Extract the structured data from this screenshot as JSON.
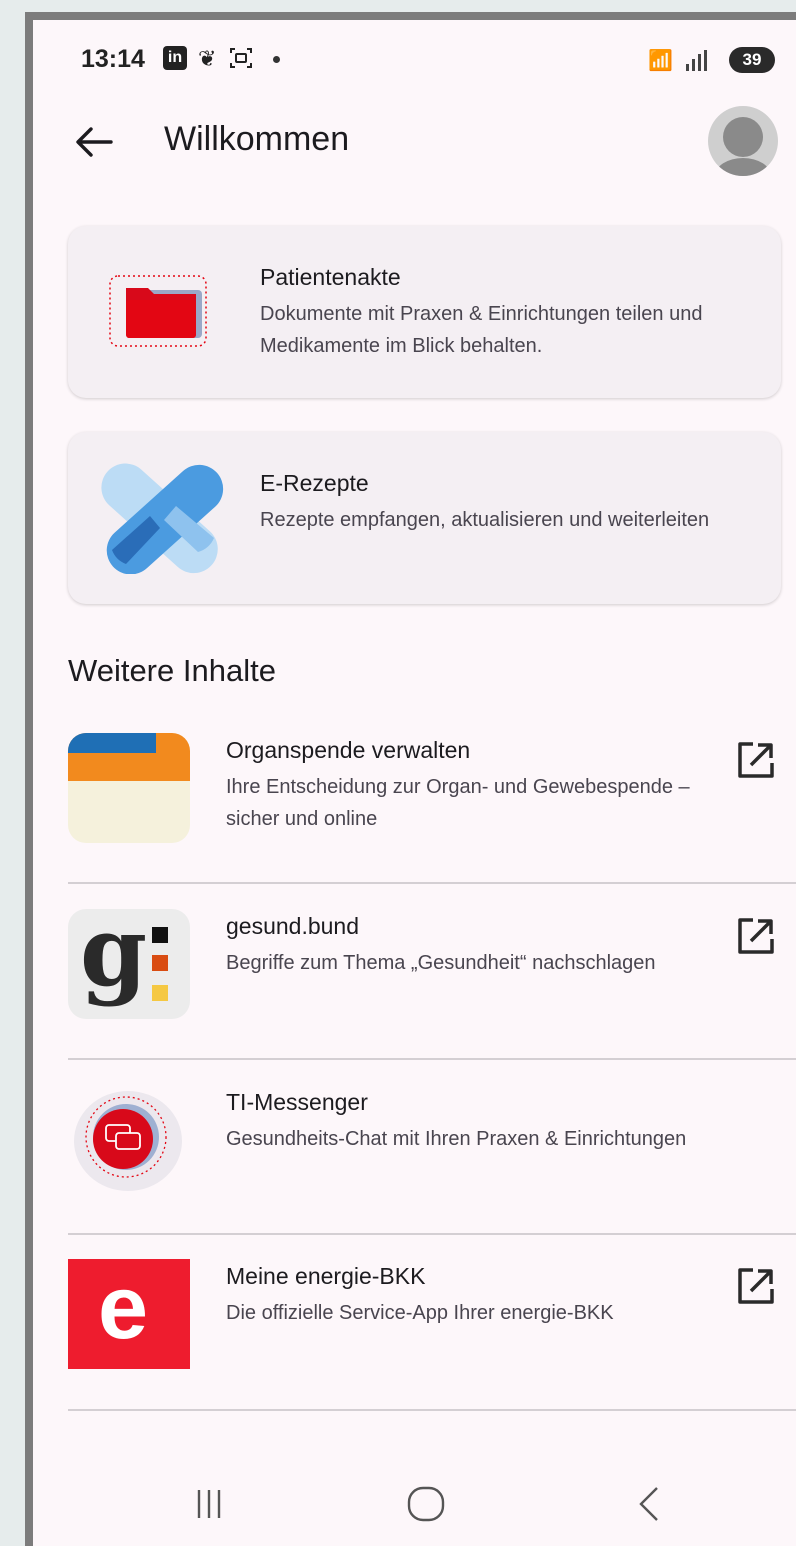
{
  "status_bar": {
    "time": "13:14",
    "linkedin_icon": "in",
    "battery": "39",
    "icons": [
      "linkedin-icon",
      "leaf-icon",
      "screenshot-icon",
      "notification-dot",
      "wifi-icon",
      "signal-icon",
      "battery-icon"
    ]
  },
  "app_bar": {
    "title": "Willkommen",
    "back_icon": "arrow-left-icon",
    "avatar_icon": "profile-avatar"
  },
  "cards": [
    {
      "title": "Patientenakte",
      "subtitle": "Dokumente mit Praxen & Einrichtungen teilen und Medikamente im Blick behalten.",
      "icon": "folder-icon"
    },
    {
      "title": "E-Rezepte",
      "subtitle": "Rezepte empfangen, aktualisieren und weiterleiten",
      "icon": "prescription-icon"
    }
  ],
  "section_title": "Weitere Inhalte",
  "more": [
    {
      "title": "Organspende verwalten",
      "subtitle": "Ihre Entscheidung zur Organ- und Gewebespende – sicher und online",
      "external": true
    },
    {
      "title": "gesund.bund",
      "subtitle": "Begriffe zum Thema „Gesundheit“ nachschlagen",
      "logo_letter": "g",
      "external": true
    },
    {
      "title": "TI-Messenger",
      "subtitle": "Gesundheits-Chat mit Ihren Praxen & Einrichtungen",
      "external": false
    },
    {
      "title": "Meine energie-BKK",
      "subtitle": "Die offizielle Service-App Ihrer energie-BKK",
      "logo_letter": "e",
      "external": true
    }
  ],
  "colors": {
    "accent_red": "#e30613",
    "blue_light": "#bcdcf5",
    "blue_mid": "#4b9be0",
    "blue_dark": "#2a6db8",
    "organ_blue": "#1f6fb5",
    "organ_orange": "#f28a1e",
    "organ_cream": "#f5f1dc",
    "bkk_red": "#ee1c2e"
  },
  "nav_bar": {
    "icons": [
      "recent-apps-icon",
      "home-icon",
      "back-nav-icon"
    ]
  }
}
